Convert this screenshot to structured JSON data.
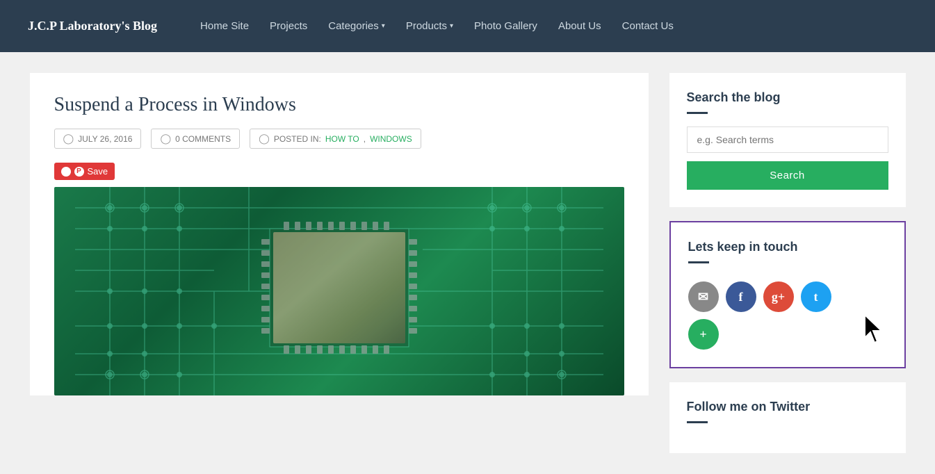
{
  "navbar": {
    "brand": "J.C.P Laboratory's Blog",
    "links": [
      {
        "id": "home-site",
        "label": "Home Site",
        "has_dropdown": false
      },
      {
        "id": "projects",
        "label": "Projects",
        "has_dropdown": false
      },
      {
        "id": "categories",
        "label": "Categories",
        "has_dropdown": true
      },
      {
        "id": "products",
        "label": "Products",
        "has_dropdown": true
      },
      {
        "id": "photo-gallery",
        "label": "Photo Gallery",
        "has_dropdown": false
      },
      {
        "id": "about-us",
        "label": "About Us",
        "has_dropdown": false
      },
      {
        "id": "contact-us",
        "label": "Contact Us",
        "has_dropdown": false
      }
    ]
  },
  "post": {
    "title": "Suspend a Process in Windows",
    "date": "JULY 26, 2016",
    "comments": "0 COMMENTS",
    "posted_in_label": "POSTED IN:",
    "categories": [
      "HOW TO",
      "WINDOWS"
    ],
    "save_label": "Save"
  },
  "sidebar": {
    "search": {
      "title": "Search the blog",
      "placeholder": "e.g. Search terms",
      "button_label": "Search"
    },
    "keep_in_touch": {
      "title": "Lets keep in touch"
    },
    "follow_twitter": {
      "title": "Follow me on Twitter"
    }
  }
}
